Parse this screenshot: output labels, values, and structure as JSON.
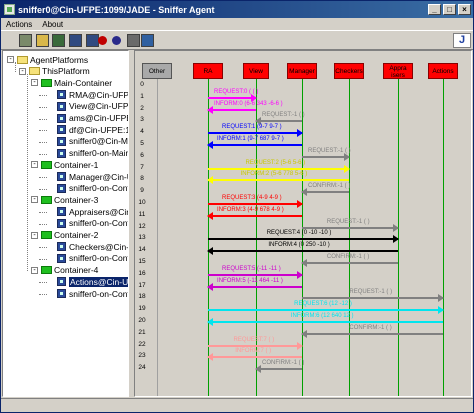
{
  "window": {
    "title": "sniffer0@Cin-UFPE:1099/JADE - Sniffer Agent",
    "min": "_",
    "max": "□",
    "close": "×"
  },
  "menu": [
    "Actions",
    "About"
  ],
  "toolbar": [
    {
      "name": "clear-canvas-icon",
      "color": "#7a8a6a"
    },
    {
      "name": "open-folder-icon",
      "color": "#d9b84a"
    },
    {
      "name": "open-snapshot-icon",
      "color": "#3a6a3a"
    },
    {
      "name": "save-icon",
      "color": "#304a80"
    },
    {
      "name": "save-messages-icon",
      "color": "#304a80"
    },
    {
      "name": "stop-sniffing-icon",
      "color": "#c00000"
    },
    {
      "name": "display-agent-icon",
      "color": "#2a2a8a"
    },
    {
      "name": "filter-icon",
      "color": "#6a6a6a"
    },
    {
      "name": "exit-icon",
      "color": "#3060a0"
    },
    {
      "name": "jade-logo",
      "text": "J",
      "color": "#2040a0"
    }
  ],
  "tree": [
    {
      "label": "AgentPlatforms",
      "type": "folder-y",
      "level": 0,
      "exp": "-"
    },
    {
      "label": "ThisPlatform",
      "type": "folder-y",
      "level": 1,
      "exp": "-"
    },
    {
      "label": "Main-Container",
      "type": "folder-g",
      "level": 2,
      "exp": "-"
    },
    {
      "label": "RMA@Cin-UFPE",
      "type": "agent",
      "level": 3
    },
    {
      "label": "View@Cin-UFPE",
      "type": "agent",
      "level": 3
    },
    {
      "label": "ams@Cin-UFPE",
      "type": "agent",
      "level": 3
    },
    {
      "label": "df@Cin-UFPE:10",
      "type": "agent",
      "level": 3
    },
    {
      "label": "sniffer0@Cin-Main-",
      "type": "agent",
      "level": 3
    },
    {
      "label": "sniffer0-on-Main-",
      "type": "agent",
      "level": 3
    },
    {
      "label": "Container-1",
      "type": "folder-g",
      "level": 2,
      "exp": "-"
    },
    {
      "label": "Manager@Cin-UFP",
      "type": "agent",
      "level": 3
    },
    {
      "label": "sniffer0-on-Conta",
      "type": "agent",
      "level": 3
    },
    {
      "label": "Container-3",
      "type": "folder-g",
      "level": 2,
      "exp": "-"
    },
    {
      "label": "Appraisers@Cin-",
      "type": "agent",
      "level": 3
    },
    {
      "label": "sniffer0-on-Conta",
      "type": "agent",
      "level": 3
    },
    {
      "label": "Container-2",
      "type": "folder-g",
      "level": 2,
      "exp": "-"
    },
    {
      "label": "Checkers@Cin-UF",
      "type": "agent",
      "level": 3
    },
    {
      "label": "sniffer0-on-Conta",
      "type": "agent",
      "level": 3
    },
    {
      "label": "Container-4",
      "type": "folder-g",
      "level": 2,
      "exp": "-"
    },
    {
      "label": "Actions@Cin-UFP",
      "type": "agent",
      "level": 3,
      "selected": true
    },
    {
      "label": "sniffer0-on-Conta",
      "type": "agent",
      "level": 3
    }
  ],
  "diagram": {
    "agents": [
      {
        "label": "Other",
        "style": "gray"
      },
      {
        "label": "RA",
        "style": "red"
      },
      {
        "label": "View",
        "style": "red"
      },
      {
        "label": "Manager",
        "style": "red"
      },
      {
        "label": "Checkers",
        "style": "red"
      },
      {
        "label": "Appra isers",
        "style": "red"
      },
      {
        "label": "Actions",
        "style": "red"
      }
    ],
    "rows": [
      "0",
      "1",
      "2",
      "3",
      "4",
      "5",
      "6",
      "7",
      "8",
      "9",
      "10",
      "11",
      "12",
      "13",
      "14",
      "15",
      "16",
      "17",
      "18",
      "19",
      "20",
      "21",
      "22",
      "23",
      "24"
    ],
    "messages": [
      {
        "row": 1,
        "from": 1,
        "to": 2,
        "color": "#ff00ff",
        "label": "REQUEST:0 ( ( )"
      },
      {
        "row": 2,
        "from": 2,
        "to": 1,
        "color": "#ff00ff",
        "label": "INFORM:0 (6-6 343 -6-6 )"
      },
      {
        "row": 3,
        "from": 3,
        "to": 2,
        "color": "#808080",
        "label": "REQUEST:-1 ( )"
      },
      {
        "row": 4,
        "from": 1,
        "to": 3,
        "color": "#0000ff",
        "label": "REQUEST:1 (9-7 9-7 )"
      },
      {
        "row": 5,
        "from": 3,
        "to": 1,
        "color": "#0000ff",
        "label": "INFORM:1 (9-7 687 9-7 )"
      },
      {
        "row": 6,
        "from": 3,
        "to": 4,
        "color": "#808080",
        "label": "REQUEST:-1 ( )"
      },
      {
        "row": 7,
        "from": 1,
        "to": 4,
        "color": "#ffff00",
        "label": "REQUEST:2 (5-6 5-6 )"
      },
      {
        "row": 8,
        "from": 4,
        "to": 1,
        "color": "#ffff00",
        "label": "INFORM:2 (5-6 778 5-6 )"
      },
      {
        "row": 9,
        "from": 4,
        "to": 3,
        "color": "#808080",
        "label": "CONFIRM:-1 ( )"
      },
      {
        "row": 10,
        "from": 1,
        "to": 3,
        "color": "#ff0000",
        "label": "REQUEST:3 (4-9 4-9 )"
      },
      {
        "row": 11,
        "from": 3,
        "to": 1,
        "color": "#ff0000",
        "label": "INFORM:3 (4-9 678 4-9 )"
      },
      {
        "row": 12,
        "from": 3,
        "to": 5,
        "color": "#808080",
        "label": "REQUEST:-1 ( )"
      },
      {
        "row": 13,
        "from": 1,
        "to": 5,
        "color": "#000000",
        "label": "REQUEST:4 (0 -10 -10 )"
      },
      {
        "row": 14,
        "from": 5,
        "to": 1,
        "color": "#000000",
        "label": "INFORM:4 (0 250 -10 )"
      },
      {
        "row": 15,
        "from": 5,
        "to": 3,
        "color": "#808080",
        "label": "CONFIRM:-1 ( )"
      },
      {
        "row": 16,
        "from": 1,
        "to": 3,
        "color": "#cc00cc",
        "label": "REQUEST:5 (-11 -11 )"
      },
      {
        "row": 17,
        "from": 3,
        "to": 1,
        "color": "#cc00cc",
        "label": "INFORM:5 (-11 464 -11 )"
      },
      {
        "row": 18,
        "from": 3,
        "to": 6,
        "color": "#808080",
        "label": "REQUEST:-1 ( )"
      },
      {
        "row": 19,
        "from": 1,
        "to": 6,
        "color": "#00e5ee",
        "label": "REQUEST:6 (12 -12 )"
      },
      {
        "row": 20,
        "from": 6,
        "to": 1,
        "color": "#00e5ee",
        "label": "INFORM:6 (12 640 12 )"
      },
      {
        "row": 21,
        "from": 6,
        "to": 3,
        "color": "#808080",
        "label": "CONFIRM:-1 ( )"
      },
      {
        "row": 22,
        "from": 1,
        "to": 3,
        "color": "#ff9999",
        "label": "REQUEST:7 ( )"
      },
      {
        "row": 23,
        "from": 3,
        "to": 1,
        "color": "#ff9999",
        "label": "INFORM:7 ( )"
      },
      {
        "row": 24,
        "from": 3,
        "to": 2,
        "color": "#808080",
        "label": "CONFIRM:-1 ( )"
      }
    ]
  }
}
